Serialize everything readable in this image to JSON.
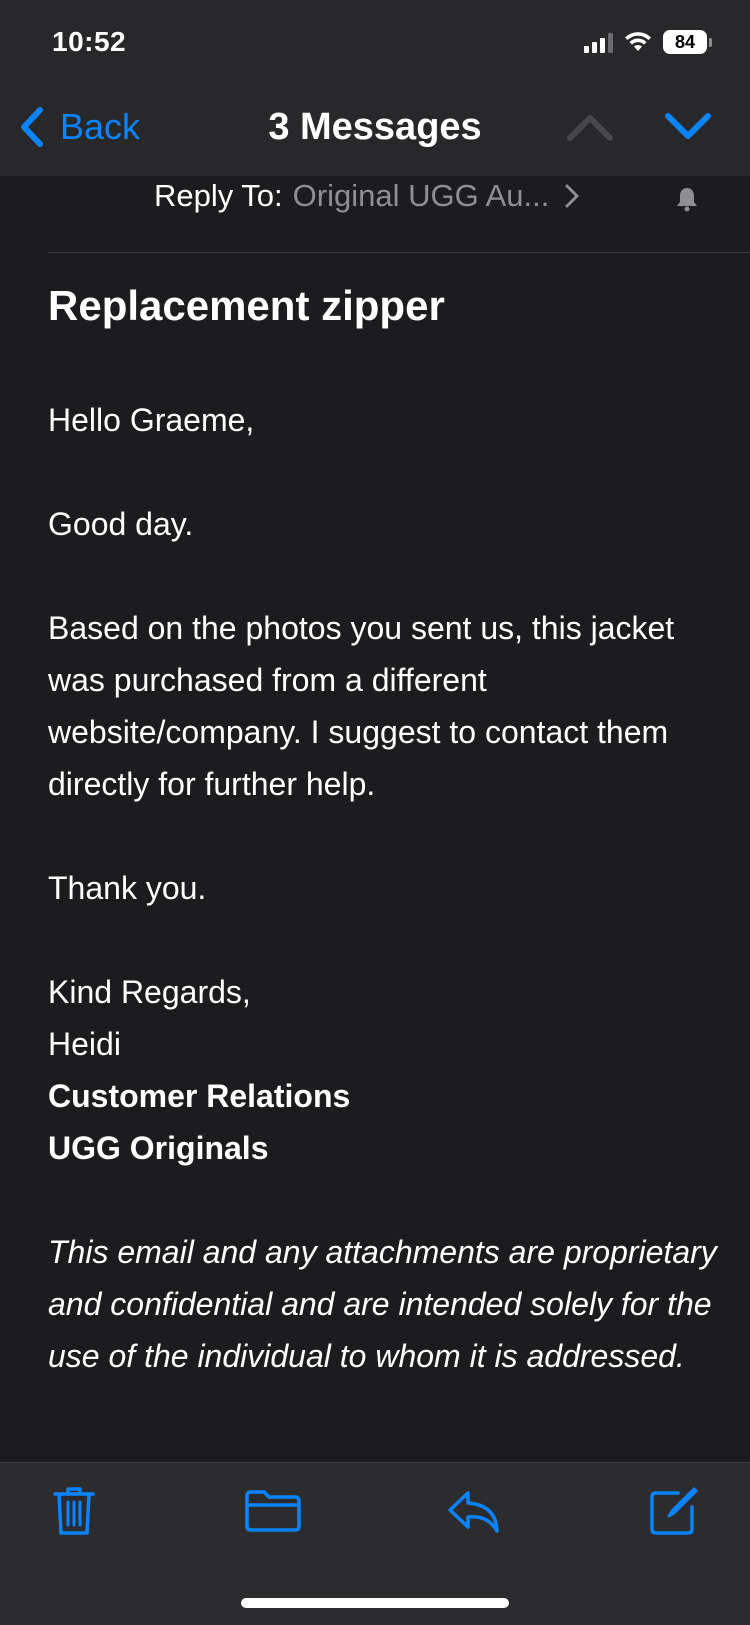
{
  "status_bar": {
    "time": "10:52",
    "battery": "84"
  },
  "nav": {
    "back_label": "Back",
    "title": "3 Messages"
  },
  "reply_to": {
    "label": "Reply To:",
    "value": "Original UGG Au..."
  },
  "email": {
    "subject": "Replacement zipper",
    "greeting": "Hello Graeme,",
    "line1": "Good day.",
    "paragraph": "Based on the photos you sent us, this jacket was purchased from a different website/company. I suggest to contact them directly for further help.",
    "thanks": "Thank you.",
    "closing": "Kind Regards,",
    "name": "Heidi",
    "department": "Customer Relations",
    "company": "UGG Originals",
    "disclaimer": "This email and any attachments are proprietary and confidential and are intended solely for the use of the individual to whom it is addressed."
  },
  "toolbar": {
    "icons": [
      "trash-icon",
      "folder-icon",
      "reply-icon",
      "compose-icon"
    ]
  },
  "colors": {
    "accent": "#0a84ff",
    "background": "#1c1c1e",
    "header_bg": "#28282a",
    "secondary_text": "#8e8e93"
  }
}
